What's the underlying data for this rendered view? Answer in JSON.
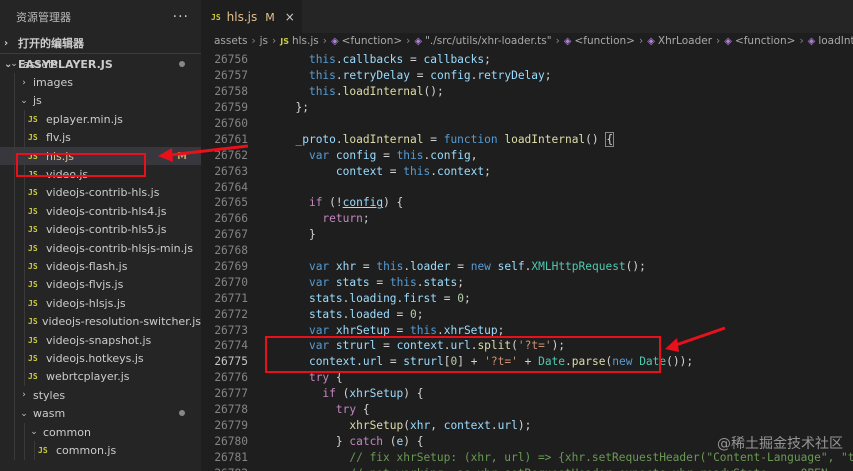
{
  "sidebar": {
    "title": "资源管理器",
    "more": "···",
    "open_editors": "打开的编辑器",
    "project": "EASYPLAYER.JS",
    "tree": [
      {
        "label": "assets",
        "kind": "folder-open",
        "depth": 1,
        "dot": true
      },
      {
        "label": "images",
        "kind": "folder",
        "depth": 2
      },
      {
        "label": "js",
        "kind": "folder-open",
        "depth": 2
      },
      {
        "label": "eplayer.min.js",
        "kind": "file",
        "depth": 3
      },
      {
        "label": "flv.js",
        "kind": "file",
        "depth": 3
      },
      {
        "label": "hls.js",
        "kind": "file",
        "depth": 3,
        "active": true,
        "badge": "M"
      },
      {
        "label": "video.js",
        "kind": "file",
        "depth": 3
      },
      {
        "label": "videojs-contrib-hls.js",
        "kind": "file",
        "depth": 3
      },
      {
        "label": "videojs-contrib-hls4.js",
        "kind": "file",
        "depth": 3
      },
      {
        "label": "videojs-contrib-hls5.js",
        "kind": "file",
        "depth": 3
      },
      {
        "label": "videojs-contrib-hlsjs-min.js",
        "kind": "file",
        "depth": 3
      },
      {
        "label": "videojs-flash.js",
        "kind": "file",
        "depth": 3
      },
      {
        "label": "videojs-flvjs.js",
        "kind": "file",
        "depth": 3
      },
      {
        "label": "videojs-hlsjs.js",
        "kind": "file",
        "depth": 3
      },
      {
        "label": "videojs-resolution-switcher.js",
        "kind": "file",
        "depth": 3
      },
      {
        "label": "videojs-snapshot.js",
        "kind": "file",
        "depth": 3
      },
      {
        "label": "videojs.hotkeys.js",
        "kind": "file",
        "depth": 3
      },
      {
        "label": "webrtcplayer.js",
        "kind": "file",
        "depth": 3
      },
      {
        "label": "styles",
        "kind": "folder",
        "depth": 2
      },
      {
        "label": "wasm",
        "kind": "folder-open",
        "depth": 2,
        "dot": true
      },
      {
        "label": "common",
        "kind": "folder-open",
        "depth": 3
      },
      {
        "label": "common.js",
        "kind": "file",
        "depth": 4
      }
    ]
  },
  "tab": {
    "icon": "JS",
    "label": "hls.js",
    "status": "M",
    "close": "×"
  },
  "breadcrumb": [
    "assets",
    "js",
    "hls.js",
    "<function>",
    "\"./src/utils/xhr-loader.ts\"",
    "<function>",
    "XhrLoader",
    "<function>",
    "loadInternal"
  ],
  "code_lines": [
    {
      "n": "26756",
      "html": "    <span class=\"kw\">this</span>.<span class=\"var\">callbacks</span> = <span class=\"var\">callbacks</span>;"
    },
    {
      "n": "26757",
      "html": "    <span class=\"kw\">this</span>.<span class=\"var\">retryDelay</span> = <span class=\"var\">config</span>.<span class=\"var\">retryDelay</span>;"
    },
    {
      "n": "26758",
      "html": "    <span class=\"kw\">this</span>.<span class=\"fn\">loadInternal</span>();"
    },
    {
      "n": "26759",
      "html": "  };"
    },
    {
      "n": "26760",
      "html": ""
    },
    {
      "n": "26761",
      "html": "  <span class=\"var\">_proto</span>.<span class=\"fn\">loadInternal</span> = <span class=\"kw\">function</span> <span class=\"fn\">loadInternal</span>() <span class=\"brk\">{</span>"
    },
    {
      "n": "26762",
      "html": "    <span class=\"kw\">var</span> <span class=\"var\">config</span> = <span class=\"kw\">this</span>.<span class=\"var\">config</span>,"
    },
    {
      "n": "26763",
      "html": "        <span class=\"var\">context</span> = <span class=\"kw\">this</span>.<span class=\"var\">context</span>;"
    },
    {
      "n": "26764",
      "html": ""
    },
    {
      "n": "26765",
      "html": "    <span class=\"ctl\">if</span> (!<span class=\"var\" style=\"text-decoration:underline\">config</span>) {"
    },
    {
      "n": "26766",
      "html": "      <span class=\"ctl\">return</span>;"
    },
    {
      "n": "26767",
      "html": "    }"
    },
    {
      "n": "26768",
      "html": ""
    },
    {
      "n": "26769",
      "html": "    <span class=\"kw\">var</span> <span class=\"var\">xhr</span> = <span class=\"kw\">this</span>.<span class=\"var\">loader</span> = <span class=\"kw\">new</span> <span class=\"var\">self</span>.<span class=\"cls\">XMLHttpRequest</span>();"
    },
    {
      "n": "26770",
      "html": "    <span class=\"kw\">var</span> <span class=\"var\">stats</span> = <span class=\"kw\">this</span>.<span class=\"var\">stats</span>;"
    },
    {
      "n": "26771",
      "html": "    <span class=\"var\">stats</span>.<span class=\"var\">loading</span>.<span class=\"var\">first</span> = <span class=\"num\">0</span>;"
    },
    {
      "n": "26772",
      "html": "    <span class=\"var\">stats</span>.<span class=\"var\">loaded</span> = <span class=\"num\">0</span>;"
    },
    {
      "n": "26773",
      "html": "    <span class=\"kw\">var</span> <span class=\"var\">xhrSetup</span> = <span class=\"kw\">this</span>.<span class=\"var\">xhrSetup</span>;"
    },
    {
      "n": "26774",
      "html": "    <span class=\"kw\">var</span> <span class=\"var\">strurl</span> = <span class=\"var\">context</span>.<span class=\"var\">url</span>.<span class=\"fn\">split</span>(<span class=\"str\">'?t='</span>);"
    },
    {
      "n": "26775",
      "html": "    <span class=\"var\">context</span>.<span class=\"var\">url</span> = <span class=\"var\">strurl</span>[<span class=\"num\">0</span>] + <span class=\"str\">'?t='</span> + <span class=\"cls\">Date</span>.<span class=\"fn\">parse</span>(<span class=\"kw\">new</span> <span class=\"cls\">Date</span>());",
      "current": true
    },
    {
      "n": "26776",
      "html": "    <span class=\"ctl\">try</span> {"
    },
    {
      "n": "26777",
      "html": "      <span class=\"ctl\">if</span> (<span class=\"var\">xhrSetup</span>) {"
    },
    {
      "n": "26778",
      "html": "        <span class=\"ctl\">try</span> {"
    },
    {
      "n": "26779",
      "html": "          <span class=\"fn\">xhrSetup</span>(<span class=\"var\">xhr</span>, <span class=\"var\">context</span>.<span class=\"var\">url</span>);"
    },
    {
      "n": "26780",
      "html": "        } <span class=\"ctl\">catch</span> (<span class=\"var\">e</span>) {"
    },
    {
      "n": "26781",
      "html": "          <span class=\"cmt\">// fix xhrSetup: (xhr, url) =&gt; {xhr.setRequestHeader(\"Content-Language\", \"test\");}</span>"
    },
    {
      "n": "26782",
      "html": "          <span class=\"cmt\">// not working, as xhr.setRequestHeader expects xhr.readyState === OPEN</span>"
    }
  ],
  "watermark": "@稀土掘金技术社区",
  "colors": {
    "highlight_box": "#e8101b",
    "sidebar_bg": "#252526",
    "editor_bg": "#1e1e1e"
  }
}
